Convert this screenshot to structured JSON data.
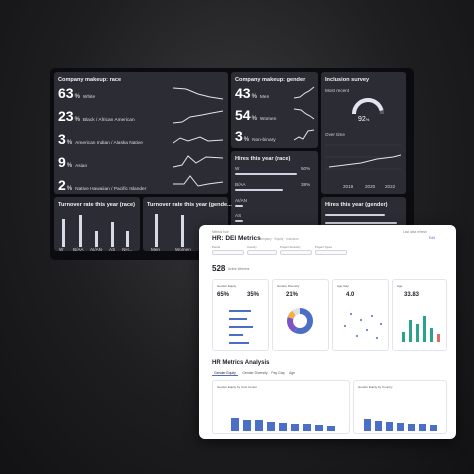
{
  "dark_dashboard": {
    "company_race": {
      "title": "Company makeup: race",
      "rows": [
        {
          "value": "63",
          "unit": "%",
          "label": "White"
        },
        {
          "value": "23",
          "unit": "%",
          "label": "Black / African American"
        },
        {
          "value": "3",
          "unit": "%",
          "label": "American Indian / Alaska Native"
        },
        {
          "value": "9",
          "unit": "%",
          "label": "Asian"
        },
        {
          "value": "2",
          "unit": "%",
          "label": "Native Hawaiian / Pacific Islander"
        }
      ]
    },
    "company_gender": {
      "title": "Company makeup: gender",
      "rows": [
        {
          "value": "43",
          "unit": "%",
          "label": "Men"
        },
        {
          "value": "54",
          "unit": "%",
          "label": "Women"
        },
        {
          "value": "3",
          "unit": "%",
          "label": "Non-binary"
        }
      ]
    },
    "inclusion_survey": {
      "title": "Inclusion survey",
      "most_recent_label": "Most recent",
      "gauge_value": "92",
      "gauge_unit": "%",
      "gauge_fraction": 0.92,
      "over_time_label": "Over time",
      "years": [
        "2018",
        "2020",
        "2022"
      ]
    },
    "hires_race": {
      "title": "Hires this year (race)",
      "rows": [
        {
          "label": "W",
          "value": "50%",
          "fraction": 0.5
        },
        {
          "label": "B/AA",
          "value": "38%",
          "fraction": 0.38
        },
        {
          "label": "AI/AN",
          "value": "",
          "fraction": 0.06
        },
        {
          "label": "AS",
          "value": "",
          "fraction": 0.06
        }
      ]
    },
    "hires_gender": {
      "title": "Hires this year (gender)"
    },
    "turnover_race": {
      "title": "Turnover rate this year (race)",
      "categories": [
        "W",
        "B/AA",
        "AI/AN",
        "AS",
        "NH..."
      ],
      "values": [
        9,
        10,
        5,
        8,
        5
      ]
    },
    "turnover_gender": {
      "title": "Turnover rate this year (gende...",
      "categories": [
        "Men",
        "Women",
        ""
      ],
      "values": [
        10,
        10,
        5
      ]
    }
  },
  "light_dashboard": {
    "breadcrumb": "Metrics hub",
    "title": "HR: DEI Metrics",
    "subtitle": "Company · Equity · Inclusion",
    "top_right": "Last data refresh",
    "edit_label": "Edit",
    "filters": [
      "Period",
      "Country",
      "Project Seniority",
      "Project Types"
    ],
    "headline_value": "528",
    "headline_label": "Active Workers",
    "cards": [
      {
        "title": "Gender Equity",
        "values": [
          "65%",
          "35%"
        ]
      },
      {
        "title": "Gender Diversity",
        "values": [
          "21%"
        ]
      },
      {
        "title": "Age Gap",
        "values": [
          "4.0"
        ]
      },
      {
        "title": "Age",
        "values": [
          "33.83"
        ]
      }
    ],
    "section_title": "HR Metrics Analysis",
    "tabs": [
      "Gender Equity",
      "Gender Diversity",
      "Pay Gap",
      "Age"
    ],
    "bottom_left_title": "Gender Equity by Cost Center",
    "bottom_right_title": "Gender Equity by Country",
    "accent": "#4a6fc4",
    "donut_colors": [
      "#4a6fc4",
      "#7b55c7",
      "#f0b23c",
      "#e0e0e8"
    ]
  }
}
